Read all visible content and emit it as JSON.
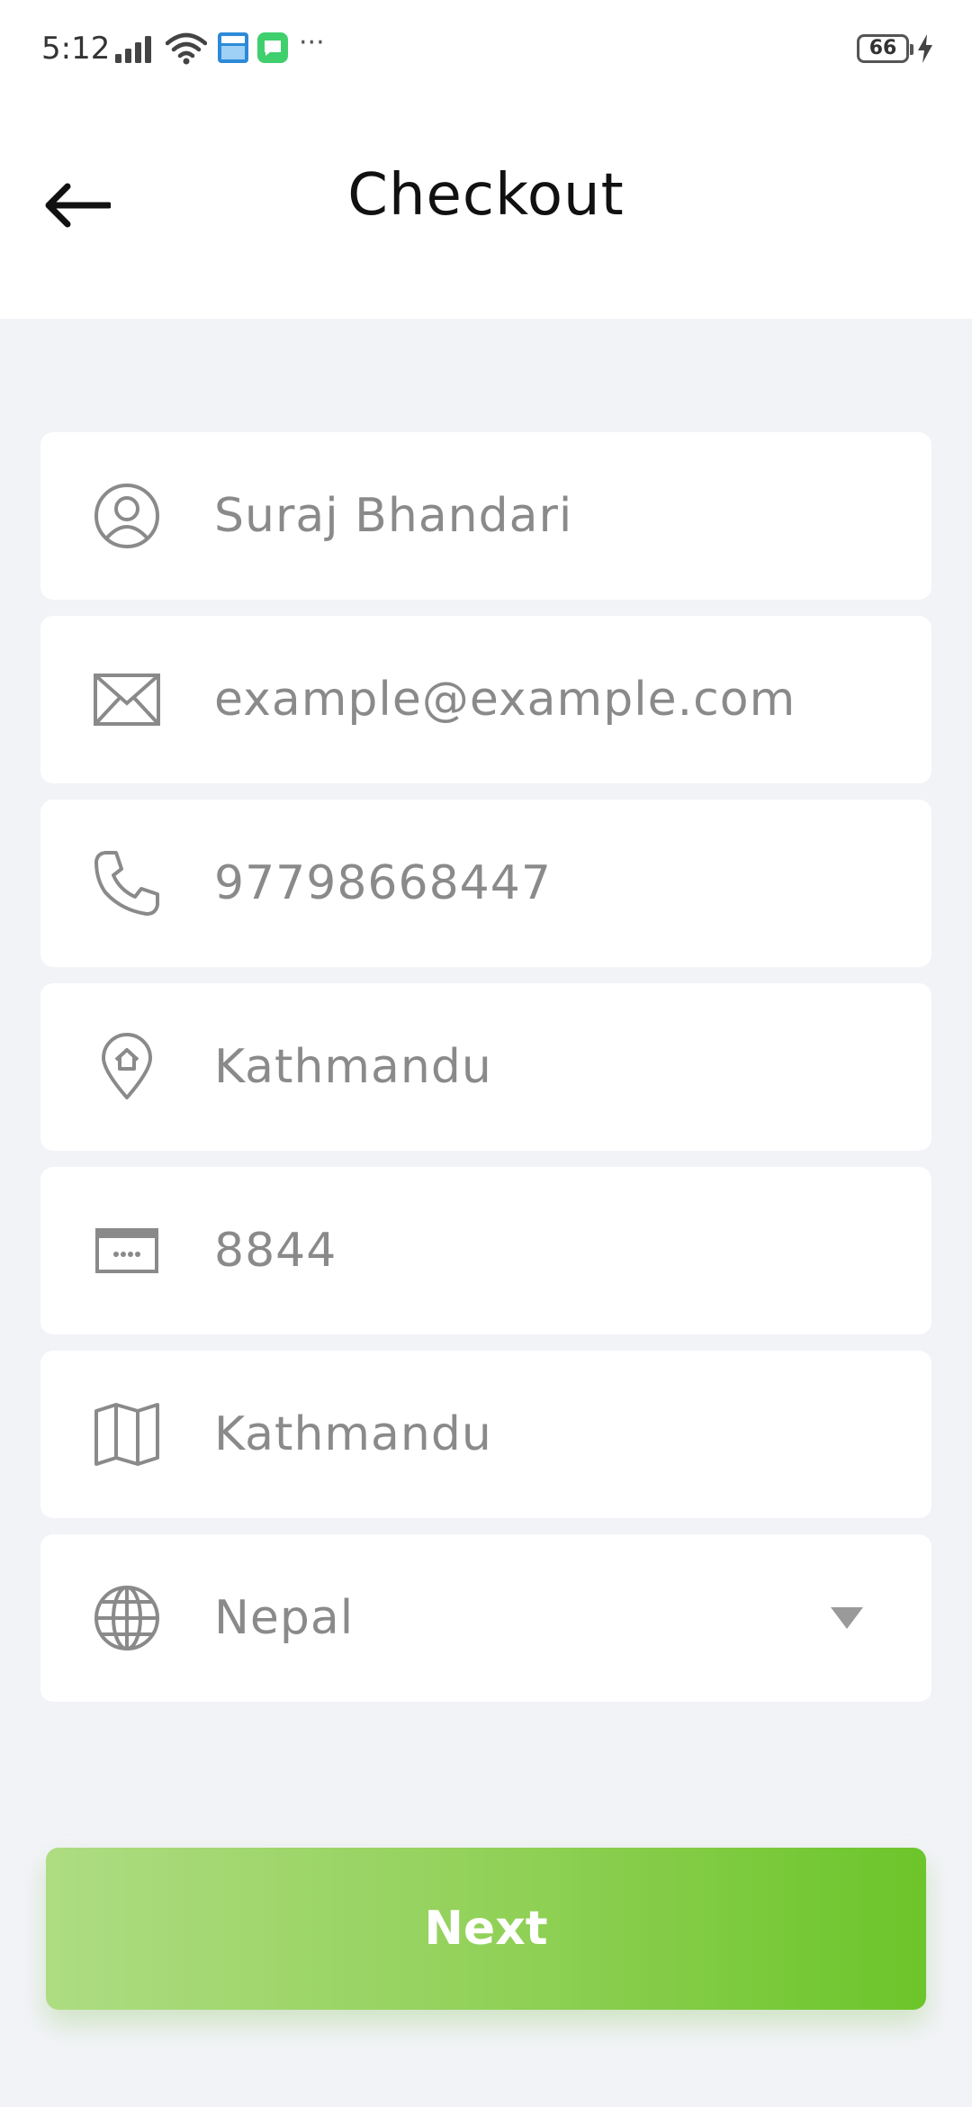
{
  "status_bar": {
    "time": "5:12",
    "battery": "66",
    "more": "···"
  },
  "header": {
    "title": "Checkout",
    "back_icon": "arrow-left-icon"
  },
  "form": {
    "fields": [
      {
        "id": "name",
        "icon": "user-circle-icon",
        "value": "Suraj Bhandari"
      },
      {
        "id": "email",
        "icon": "envelope-icon",
        "value": "example@example.com"
      },
      {
        "id": "phone",
        "icon": "phone-icon",
        "value": "97798668447"
      },
      {
        "id": "address",
        "icon": "home-location-icon",
        "value": "Kathmandu"
      },
      {
        "id": "postal_code",
        "icon": "postal-card-icon",
        "value": "8844"
      },
      {
        "id": "city",
        "icon": "map-icon",
        "value": "Kathmandu"
      },
      {
        "id": "country",
        "icon": "globe-icon",
        "value": "Nepal"
      }
    ]
  },
  "actions": {
    "next_label": "Next"
  },
  "colors": {
    "accent_start": "#aedc82",
    "accent_end": "#6cc52a",
    "background": "#f2f3f7",
    "field_text": "#8a8a8a"
  }
}
